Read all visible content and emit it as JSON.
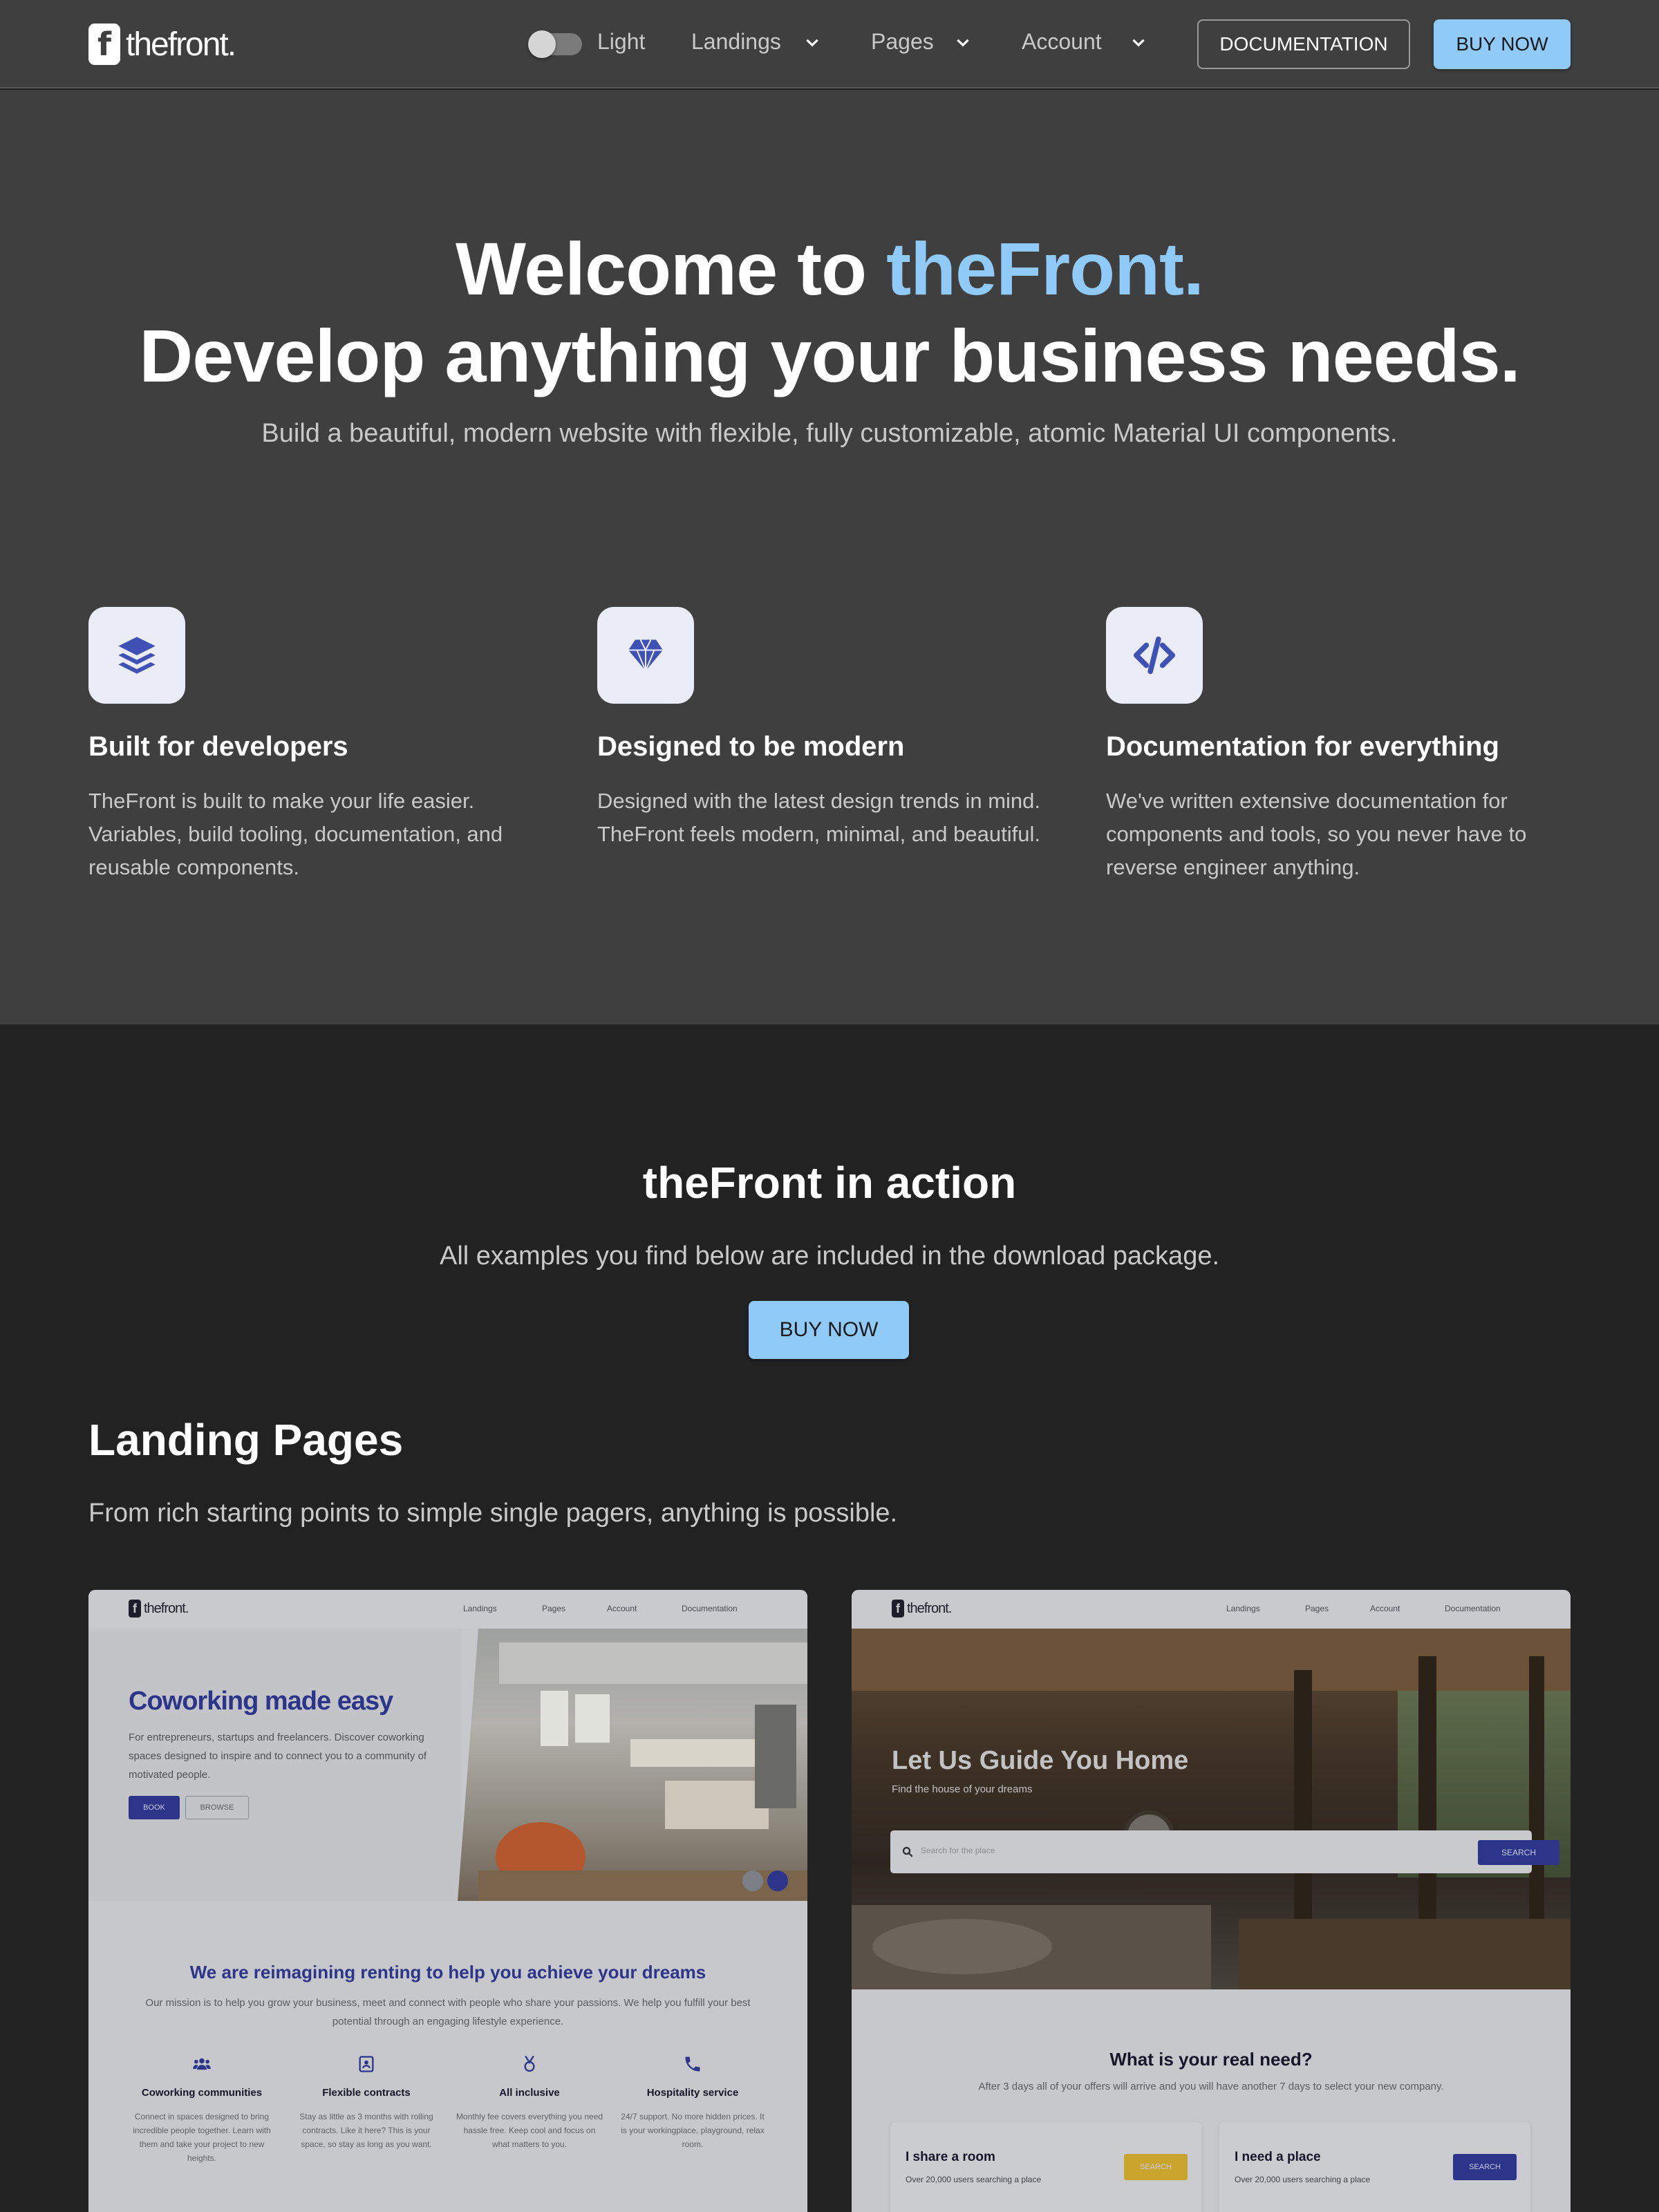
{
  "header": {
    "logo_mark": "f",
    "logo_text": "thefront.",
    "theme_toggle_label": "Light",
    "nav": [
      "Landings",
      "Pages",
      "Account"
    ],
    "documentation_label": "DOCUMENTATION",
    "buy_label": "BUY NOW"
  },
  "hero": {
    "title_prefix": "Welcome to ",
    "title_accent": "theFront.",
    "title_line2": "Develop anything your business needs.",
    "subtitle": "Build a beautiful, modern website with flexible, fully customizable, atomic Material UI components.",
    "accent_color": "#90caf9"
  },
  "features": [
    {
      "icon": "layers-icon",
      "title": "Built for developers",
      "text": "TheFront is built to make your life easier. Variables, build tooling, documentation, and reusable components."
    },
    {
      "icon": "diamond-icon",
      "title": "Designed to be modern",
      "text": "Designed with the latest design trends in mind. TheFront feels modern, minimal, and beautiful."
    },
    {
      "icon": "code-icon",
      "title": "Documentation for everything",
      "text": "We've written extensive documentation for components and tools, so you never have to reverse engineer anything."
    }
  ],
  "action": {
    "title": "theFront in action",
    "subtitle": "All examples you find below are included in the download package.",
    "buy_label": "BUY NOW"
  },
  "landing_pages": {
    "title": "Landing Pages",
    "subtitle": "From rich starting points to simple single pagers, anything is possible."
  },
  "preview_coworking": {
    "logo_text": "thefront.",
    "nav": [
      "Landings",
      "Pages",
      "Account",
      "Documentation"
    ],
    "heading_prefix": "Coworking made ",
    "heading_accent": "easy",
    "text": "For entrepreneurs, startups and freelancers. Discover coworking spaces designed to inspire and to connect you to a community of motivated people.",
    "book_label": "BOOK",
    "browse_label": "BROWSE",
    "mission_prefix": "We are reimagining renting to help you ",
    "mission_accent": "achieve your dreams",
    "mission_text": "Our mission is to help you grow your business, meet and connect with people who share your passions. We help you fulfill your best potential through an engaging lifestyle experience.",
    "features": [
      {
        "icon": "people-icon",
        "title": "Coworking communities",
        "text": "Connect in spaces designed to bring incredible people together. Learn with them and take your project to new heights."
      },
      {
        "icon": "contract-icon",
        "title": "Flexible contracts",
        "text": "Stay as little as 3 months with rolling contracts. Like it here? This is your space, so stay as long as you want."
      },
      {
        "icon": "medal-icon",
        "title": "All inclusive",
        "text": "Monthly fee covers everything you need hassle free. Keep cool and focus on what matters to you."
      },
      {
        "icon": "phone-icon",
        "title": "Hospitality service",
        "text": "24/7 support. No more hidden prices. It is your workingplace, playground, relax room."
      }
    ]
  },
  "preview_rental": {
    "logo_text": "thefront.",
    "nav": [
      "Landings",
      "Pages",
      "Account",
      "Documentation"
    ],
    "heading": "Let Us Guide You Home",
    "subheading": "Find the house of your dreams",
    "search_placeholder": "Search for the place",
    "search_label": "SEARCH",
    "need_title": "What is your real need?",
    "need_text": "After 3 days all of your offers will arrive and you will have another 7 days to select your new company.",
    "boxes": [
      {
        "title": "I share a room",
        "text": "Over 20,000 users searching a place",
        "button": "SEARCH",
        "button_color": "#c9a52e"
      },
      {
        "title": "I need a place",
        "text": "Over 20,000 users searching a place",
        "button": "SEARCH",
        "button_color": "#2c3589"
      }
    ]
  }
}
